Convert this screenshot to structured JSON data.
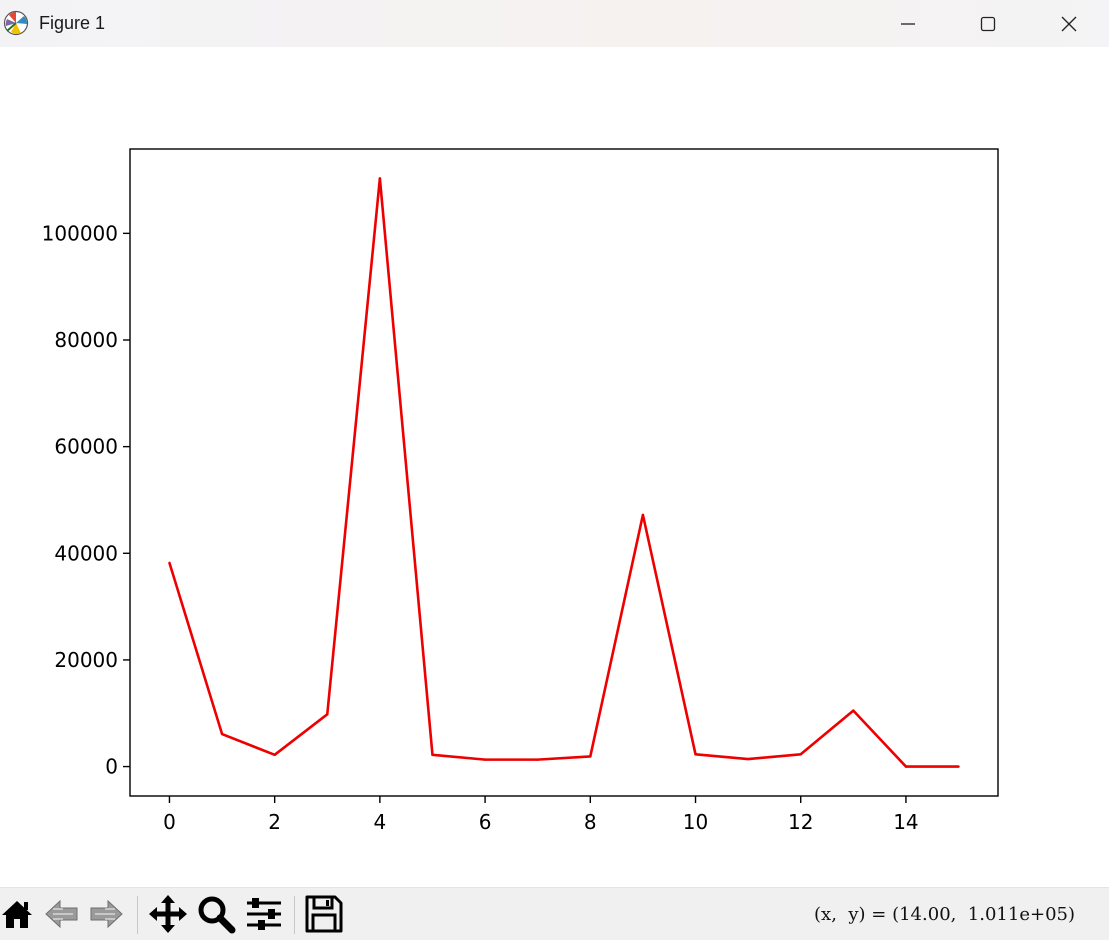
{
  "window": {
    "title": "Figure 1"
  },
  "colors": {
    "line": "#ee0000",
    "axes": "#000000",
    "toolbar_bg": "#f0f0f0"
  },
  "chart_data": {
    "type": "line",
    "title": "",
    "xlabel": "",
    "ylabel": "",
    "x": [
      0,
      1,
      2,
      3,
      4,
      5,
      6,
      7,
      8,
      9,
      10,
      11,
      12,
      13,
      14,
      15
    ],
    "series": [
      {
        "values": [
          38200,
          6100,
          2200,
          9800,
          110300,
          2200,
          1300,
          1300,
          1900,
          47200,
          2300,
          1400,
          2300,
          10500,
          0,
          0
        ]
      }
    ],
    "xlim": [
      -0.75,
      15.75
    ],
    "ylim": [
      -5520,
      115820
    ],
    "xticks": [
      0,
      2,
      4,
      6,
      8,
      10,
      12,
      14
    ],
    "xtick_labels": [
      "0",
      "2",
      "4",
      "6",
      "8",
      "10",
      "12",
      "14"
    ],
    "yticks": [
      0,
      20000,
      40000,
      60000,
      80000,
      100000
    ],
    "ytick_labels": [
      "0",
      "20000",
      "40000",
      "60000",
      "80000",
      "100000"
    ],
    "grid": false,
    "legend": "none"
  },
  "toolbar": {
    "icons": [
      "home-icon",
      "back-icon",
      "forward-icon",
      "pan-icon",
      "zoom-icon",
      "configure-icon",
      "save-icon"
    ],
    "coords_text": "(x,  y) = (14.00,  1.011e+05)"
  }
}
